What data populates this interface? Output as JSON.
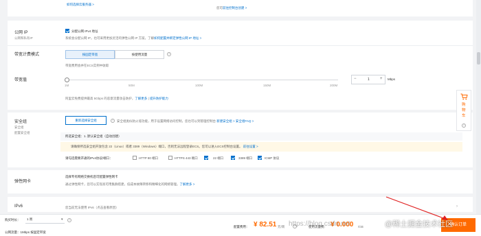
{
  "top_links": {
    "link1": "如何选择云服务器 >",
    "link2": "您可",
    "link3": "前往控制台创建 >"
  },
  "public_ip": {
    "label": "公网 IP",
    "sublabel": "公网和私有IP",
    "checkbox_label": "分配公网 IPv4 地址",
    "desc_prefix": "系统会分配公网 IP，也可采用更加灵活的弹性公网 IP 方案，了解",
    "desc_link": "如何配置并绑定弹性公网 IP 地址 >"
  },
  "billing": {
    "label": "带宽计费模式",
    "options": [
      "按固定带宽",
      "按使用流量"
    ],
    "desc": "带宽费用会并在ECS实例中收取"
  },
  "bandwidth": {
    "label": "带宽值",
    "ticks": [
      "1M",
      "50M",
      "100M",
      "150M",
      "200M"
    ],
    "value": "1",
    "unit": "Mbps",
    "minus": "−",
    "plus": "+",
    "desc_prefix": "阿里云免费提供最高 5Gbps 的恶意流量攻击防护，",
    "desc_link1": "了解更多",
    "desc_sep": " | ",
    "desc_link2": "提升防护能力"
  },
  "security_group": {
    "label": "安全组",
    "sublabel1": "安全组",
    "sublabel2": "配置安全组",
    "reselect_button": "重新选择安全组",
    "desc": "安全组类似防火墙功能，用于设置网络访问控制，您也可以到管理控制台",
    "create_link": "新建安全组 >",
    "faq_link": "安全组FAQ >",
    "selected_prefix": "所选安全组：",
    "selected_value": "1. 默认安全组（自动创建）",
    "warning_text": "请确保所选安全组开放包含 22（Linux）或者 3389（Windows）端口，否则无法远程登录ECS。您可以进入ECS控制台设置。",
    "warning_link": "前往设置 >",
    "ports_label": "请勾选需要开通的IPv4协议/端口：",
    "ports": [
      {
        "label": "HTTP 80 端口",
        "checked": false
      },
      {
        "label": "HTTPS 443 端口",
        "checked": false
      },
      {
        "label": "22 端口",
        "checked": true
      },
      {
        "label": "3389 端口",
        "checked": true
      },
      {
        "label": "ICMP 协议",
        "checked": true
      }
    ]
  },
  "eni": {
    "label": "弹性网卡",
    "desc1": "选择专有网络交换机后可配置弹性网卡",
    "desc2": "通过弹性网卡，您可以实现高可用集群搭建，低成本故障转移和精细化的网络管理。",
    "link": "了解更多 >"
  },
  "ipv6": {
    "label": "IPv6",
    "desc": "您当前无法使用 IPv6（点击查看原因）"
  },
  "bottom_bar": {
    "duration_label": "购买时长：",
    "duration_value": "1 周",
    "public_ip_label": "公网流量：",
    "public_ip_value": "1Mbps 按固定带宽",
    "config_fee_label": "配置费用：",
    "config_fee_value": "¥ 82.51",
    "config_fee_unit": "元/周",
    "traffic_fee_label": "使用流量费：",
    "traffic_fee_value": "¥ 0.000",
    "traffic_fee_unit": "/GB",
    "action_button": "确认订单"
  },
  "side_cart": {
    "label": "购物车"
  },
  "watermarks": {
    "center": "https://blog.csdn.net",
    "right": "@稀土掘金技术社区"
  },
  "colors": {
    "accent": "#0070cc",
    "orange": "#ff6a00",
    "price": "#ff6a00",
    "warning_bg": "#fff8e6"
  }
}
